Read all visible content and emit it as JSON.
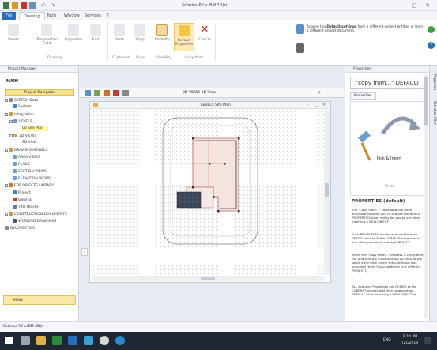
{
  "window": {
    "title": "Solarius PV v.IBM 3D(r)",
    "controls": {
      "minimize": "–",
      "maximize": "▢",
      "close": "✕"
    }
  },
  "ribbon": {
    "tabs": [
      {
        "label": "File"
      },
      {
        "label": "Drawing"
      },
      {
        "label": "Tools"
      },
      {
        "label": "Window"
      },
      {
        "label": "Services"
      },
      {
        "label": "?"
      }
    ],
    "buttons": [
      {
        "label": "Select"
      },
      {
        "label": "Photovoltaic Field"
      },
      {
        "label": "Properties"
      },
      {
        "label": "Edit"
      },
      {
        "label": "Paste"
      },
      {
        "label": "Snap"
      },
      {
        "label": "Visibility"
      },
      {
        "label": "Default Properties"
      },
      {
        "label": "Cancel"
      }
    ],
    "groups": {
      "drawing": "Drawing",
      "clipboard": "Clipboard",
      "snap": "Snap",
      "visibility": "Visibility",
      "copy_from": "Copy from..."
    },
    "tip_text_a": "Acquire the",
    "tip_text_bold": "Default settings",
    "tip_text_b": "from a different project entities or from a different project document."
  },
  "left_panel": {
    "header": "Project Manager",
    "section": "MAIN",
    "subheader": "Project Navigator",
    "tree": [
      {
        "label": "SYSTEM Data"
      },
      {
        "label": "System"
      },
      {
        "label": "Integration"
      },
      {
        "label": "LEVELS"
      },
      {
        "label": "00 Site Plan"
      },
      {
        "label": "3D VIEWS"
      },
      {
        "label": "3D View"
      },
      {
        "label": "DRAWING MODELS"
      },
      {
        "label": "AREA VIEWS"
      },
      {
        "label": "PLANS"
      },
      {
        "label": "SECTION VIEWS"
      },
      {
        "label": "ELEVATION VIEWS"
      },
      {
        "label": "EDF OBJECTS LIBRARY"
      },
      {
        "label": "Project"
      },
      {
        "label": "General"
      },
      {
        "label": "Title Blocks"
      },
      {
        "label": "CONSTRUCTION DOCUMENTS"
      },
      {
        "label": "WORKING DRAWINGS"
      },
      {
        "label": "DIAGNOSTICS"
      }
    ],
    "footer_button": "MAIN"
  },
  "workspace": {
    "doc_tab": "3D VIEWS 3D View",
    "viewport_title": "LEVELS Site Plan"
  },
  "right_panel": {
    "header": "Properties",
    "title": "\"copy from...\" DEFAULT",
    "tab": "Properties",
    "pick_label": "Pick & Insert",
    "sub_label": "-Photo-",
    "section_title": "PROPERTIES (default)",
    "para1": "The \"Copy From...\" command has been activated allowing you to acquire the default PROPERTIES of an entity for you to use when inserting a NEW OBJECT.",
    "para2": "Such PROPERTIES can be acquired from an ENTITY present in the CURRENT project or in any other previously created PROJECT.",
    "para3": "When the \"Copy From...\" process is completed, the program will automatically go back to the same VIEW from where the command was launched (even if you switched to a different PROJECT).",
    "para4": "ALL acquired Properties are COPIED to the CURRENT project and then proposed as DEFAULT when inserting a NEW OBJECT of",
    "side_tabs": [
      "Properties",
      "Selection Filter"
    ]
  },
  "status": {
    "text": "Solarius PV v.IBM 3D(r)"
  },
  "taskbar": {
    "time": "9:14 PM",
    "date": "7/21/2019",
    "lang": "ENG"
  },
  "colors": {
    "accent": "#2a6ebb",
    "selection": "#fff59a",
    "taskbar": "#1f2733"
  }
}
